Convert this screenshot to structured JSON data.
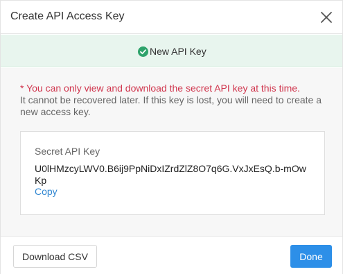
{
  "dialog": {
    "title": "Create API Access Key",
    "close_icon": "close-icon"
  },
  "banner": {
    "icon": "check-circle-icon",
    "text": "New API Key",
    "color_success": "#2ea36b"
  },
  "notice": {
    "warning": "* You can only view and download the secret API key at this time.",
    "info": "It cannot be recovered later. If this key is lost, you will need to create a new access key."
  },
  "key_card": {
    "label": "Secret API Key",
    "value": "U0lHMzcyLWV0.B6ij9PpNiDxIZrdZlZ8O7q6G.VxJxEsQ.b-mOwKp",
    "copy_label": "Copy"
  },
  "footer": {
    "download_label": "Download CSV",
    "done_label": "Done",
    "accent_color": "#2d8fe8"
  }
}
